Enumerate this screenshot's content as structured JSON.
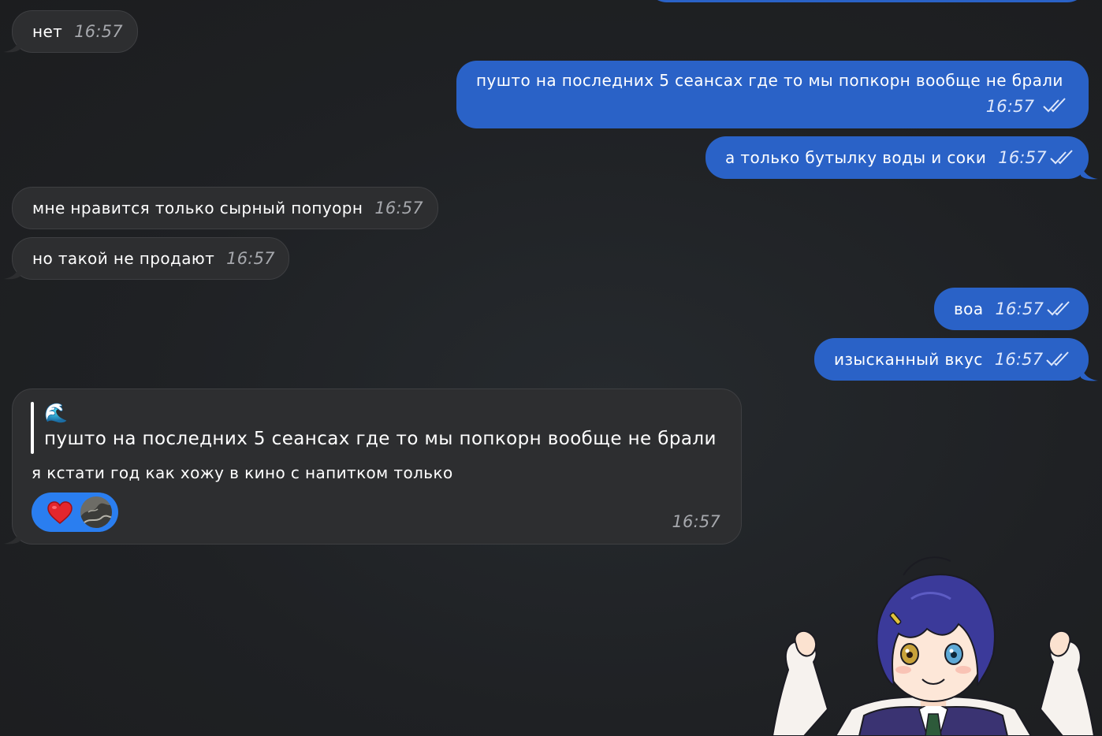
{
  "colors": {
    "background": "#1f2123",
    "incoming_bubble": "#2d2e30",
    "outgoing_bubble": "#2a62c7",
    "reaction_pill": "#2a7ef0"
  },
  "messages": [
    {
      "id": "m1",
      "direction": "incoming",
      "text": "нет",
      "time": "16:57"
    },
    {
      "id": "m2",
      "direction": "outgoing",
      "text": "пушто на последних 5 сеансах где то мы попкорн вообще не брали",
      "time": "16:57",
      "status": "read"
    },
    {
      "id": "m3",
      "direction": "outgoing",
      "text": "а только бутылку воды и соки",
      "time": "16:57",
      "status": "read"
    },
    {
      "id": "m4",
      "direction": "incoming",
      "text": "мне нравится только сырный попуорн",
      "time": "16:57"
    },
    {
      "id": "m5",
      "direction": "incoming",
      "text": "но такой не продают",
      "time": "16:57"
    },
    {
      "id": "m6",
      "direction": "outgoing",
      "text": "воа",
      "time": "16:57",
      "status": "read"
    },
    {
      "id": "m7",
      "direction": "outgoing",
      "text": "изысканный вкус",
      "time": "16:57",
      "status": "read"
    },
    {
      "id": "m8",
      "direction": "incoming",
      "reply": {
        "author_icon": "wave-emoji-icon",
        "author_emoji": "🌊",
        "quoted_text": "пушто на последних 5 сеансах где то мы попкорн вообще не брали"
      },
      "text": "я кстати год как хожу в кино с напитком только",
      "time": "16:57",
      "reactions": [
        {
          "emoji": "❤️",
          "icon": "heart-icon"
        },
        {
          "icon": "reactor-avatar"
        }
      ]
    }
  ],
  "sticker": {
    "icon": "anime-girl-sticker"
  }
}
